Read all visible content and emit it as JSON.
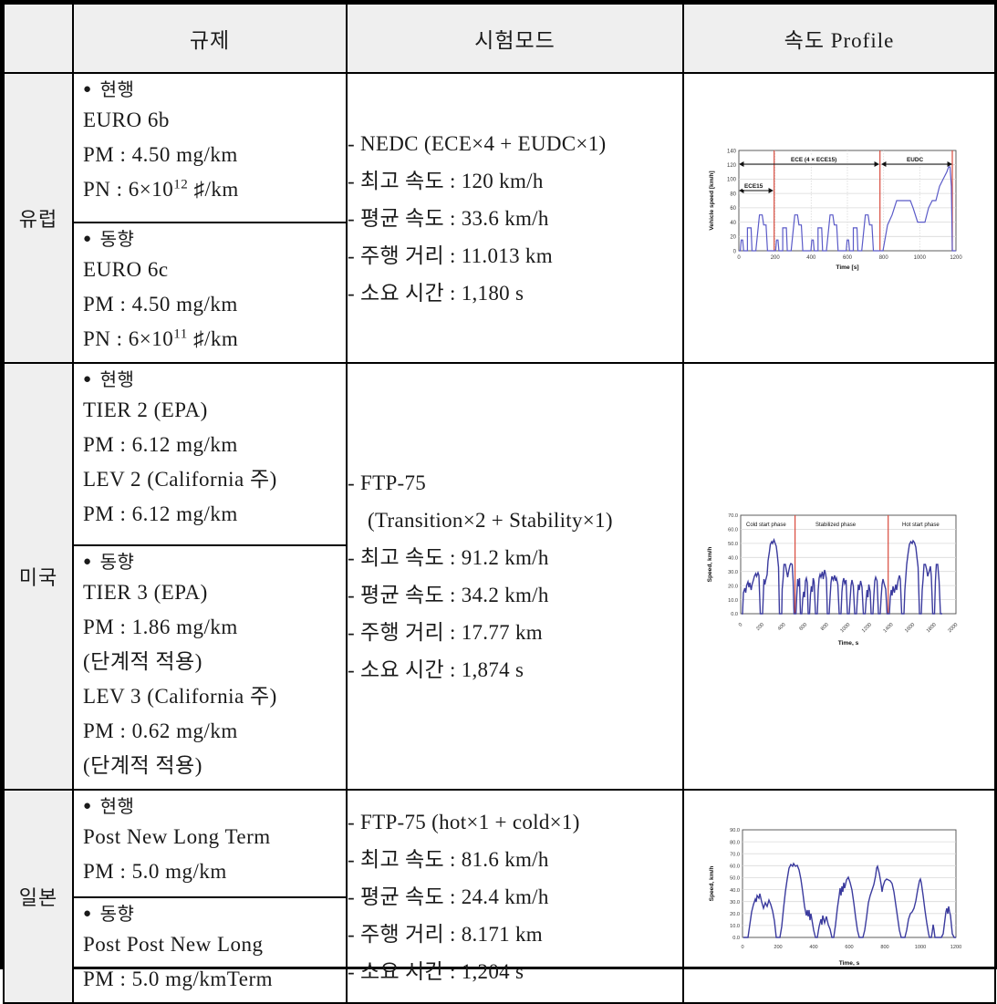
{
  "table": {
    "headers": [
      "",
      "규제",
      "시험모드",
      "속도 Profile"
    ],
    "rows": [
      {
        "region": "유럽",
        "regulation_blocks": [
          {
            "bullet": "현행",
            "lines": [
              {
                "text": "EURO 6b"
              },
              {
                "text": "PM : 4.50 mg/km"
              },
              {
                "prefix": "PN : 6×10",
                "sup": "12",
                "suffix": " ♯/km"
              }
            ]
          },
          {
            "bullet": "동향",
            "lines": [
              {
                "text": "EURO 6c"
              },
              {
                "text": "PM : 4.50 mg/km"
              },
              {
                "prefix": "PN : 6×10",
                "sup": "11",
                "suffix": " ♯/km"
              }
            ]
          }
        ],
        "test_mode": [
          "- NEDC (ECE×4 + EUDC×1)",
          "- 최고 속도 : 120 km/h",
          "- 평균 속도 : 33.6 km/h",
          "- 주행 거리 : 11.013 km",
          "- 소요 시간 : 1,180 s"
        ],
        "chart_key": "nedc"
      },
      {
        "region": "미국",
        "regulation_blocks": [
          {
            "bullet": "현행",
            "lines": [
              {
                "text": "TIER 2 (EPA)"
              },
              {
                "text": "PM : 6.12 mg/km"
              },
              {
                "text": "LEV 2 (California 주)"
              },
              {
                "text": "PM : 6.12 mg/km"
              }
            ]
          },
          {
            "bullet": "동향",
            "lines": [
              {
                "text": "TIER 3 (EPA)"
              },
              {
                "text": "PM : 1.86 mg/km"
              },
              {
                "text": "(단계적 적용)"
              },
              {
                "text": "LEV 3 (California 주)"
              },
              {
                "text": "PM : 0.62 mg/km"
              },
              {
                "text": "(단계적 적용)"
              }
            ]
          }
        ],
        "test_mode": [
          "- FTP-75",
          "(Transition×2 + Stability×1)",
          "- 최고 속도 : 91.2 km/h",
          "- 평균 속도 : 34.2 km/h",
          "- 주행 거리 : 17.77 km",
          "- 소요 시간 : 1,874 s"
        ],
        "chart_key": "ftp75"
      },
      {
        "region": "일본",
        "regulation_blocks": [
          {
            "bullet": "현행",
            "lines": [
              {
                "text": "Post New Long Term"
              },
              {
                "text": "PM : 5.0 mg/km"
              }
            ]
          },
          {
            "bullet": "동향",
            "lines": [
              {
                "text": "Post Post New Long"
              },
              {
                "text": "PM : 5.0 mg/kmTerm"
              }
            ]
          }
        ],
        "test_mode": [
          "- FTP-75 (hot×1 + cold×1)",
          "- 최고 속도 : 81.6 km/h",
          "- 평균 속도 : 24.4 km/h",
          "- 주행 거리 : 8.171 km",
          "- 소요 시간 : 1,204 s"
        ],
        "chart_key": "jc08"
      }
    ]
  },
  "chart_data": [
    {
      "key": "nedc",
      "type": "line",
      "title": "",
      "xlabel": "Time [s]",
      "ylabel": "Vehicle speed [km/h]",
      "xlim": [
        0,
        1200
      ],
      "ylim": [
        0,
        140
      ],
      "xticks": [
        0,
        200,
        400,
        600,
        800,
        1000,
        1200
      ],
      "yticks": [
        0,
        20,
        40,
        60,
        80,
        100,
        120,
        140
      ],
      "grid": true,
      "annotations": [
        "ECE15",
        "ECE (4 × ECE15)",
        "EUDC"
      ],
      "markers_x": [
        195,
        780,
        1180
      ],
      "x": [
        0,
        11,
        15,
        23,
        28,
        49,
        61,
        85,
        96,
        117,
        143,
        155,
        163,
        176,
        188,
        195,
        201,
        206,
        212,
        217,
        228,
        250,
        262,
        286,
        297,
        318,
        344,
        356,
        364,
        377,
        389,
        396,
        402,
        407,
        413,
        418,
        429,
        451,
        463,
        487,
        498,
        519,
        545,
        557,
        565,
        578,
        590,
        597,
        603,
        608,
        614,
        619,
        630,
        652,
        664,
        688,
        699,
        720,
        746,
        758,
        766,
        779,
        791,
        800,
        813,
        840,
        860,
        880,
        900,
        917,
        930,
        948,
        965,
        985,
        1010,
        1030,
        1050,
        1065,
        1085,
        1100,
        1120,
        1135,
        1150,
        1160,
        1175,
        1190,
        1200
      ],
      "y": [
        0,
        0,
        15,
        15,
        0,
        32,
        32,
        0,
        32,
        0,
        50,
        50,
        35,
        35,
        0,
        0,
        15,
        15,
        0,
        0,
        32,
        32,
        0,
        32,
        0,
        50,
        50,
        35,
        35,
        0,
        0,
        15,
        15,
        0,
        0,
        32,
        32,
        0,
        32,
        0,
        50,
        50,
        35,
        35,
        0,
        0,
        15,
        15,
        0,
        0,
        32,
        32,
        0,
        32,
        0,
        50,
        50,
        35,
        35,
        0,
        0,
        0,
        35,
        50,
        70,
        70,
        70,
        50,
        50,
        50,
        50,
        70,
        70,
        70,
        70,
        100,
        100,
        100,
        120,
        120,
        100,
        70,
        0,
        0,
        0
      ]
    },
    {
      "key": "ftp75",
      "type": "line",
      "title": "",
      "xlabel": "Time, s",
      "ylabel": "Speed, km/h",
      "xlim": [
        0,
        2000
      ],
      "ylim": [
        0,
        70
      ],
      "xticks": [
        0,
        200,
        400,
        600,
        800,
        1000,
        1200,
        1400,
        1600,
        1800,
        2000
      ],
      "yticks": [
        "0.0",
        "10.0",
        "20.0",
        "30.0",
        "40.0",
        "50.0",
        "60.0",
        "70.0"
      ],
      "grid": true,
      "annotations": [
        "Cold start phase",
        "Stabilized phase",
        "Hot start phase"
      ],
      "markers_x": [
        505,
        1370
      ]
    },
    {
      "key": "jc08",
      "type": "line",
      "title": "",
      "xlabel": "Time, s",
      "ylabel": "Speed, km/h",
      "xlim": [
        0,
        1200
      ],
      "ylim": [
        0,
        90
      ],
      "xticks": [
        0,
        200,
        400,
        600,
        800,
        1000,
        1200
      ],
      "yticks": [
        "0.0",
        "10.0",
        "20.0",
        "30.0",
        "40.0",
        "50.0",
        "60.0",
        "70.0",
        "80.0",
        "90.0"
      ],
      "grid": true,
      "annotations": [],
      "markers_x": []
    }
  ],
  "colors": {
    "header_bg": "#efefef",
    "border": "#000000",
    "trace": "#5a5ac8",
    "trace_dark": "#3b3b9e",
    "marker": "#d94a3d"
  }
}
